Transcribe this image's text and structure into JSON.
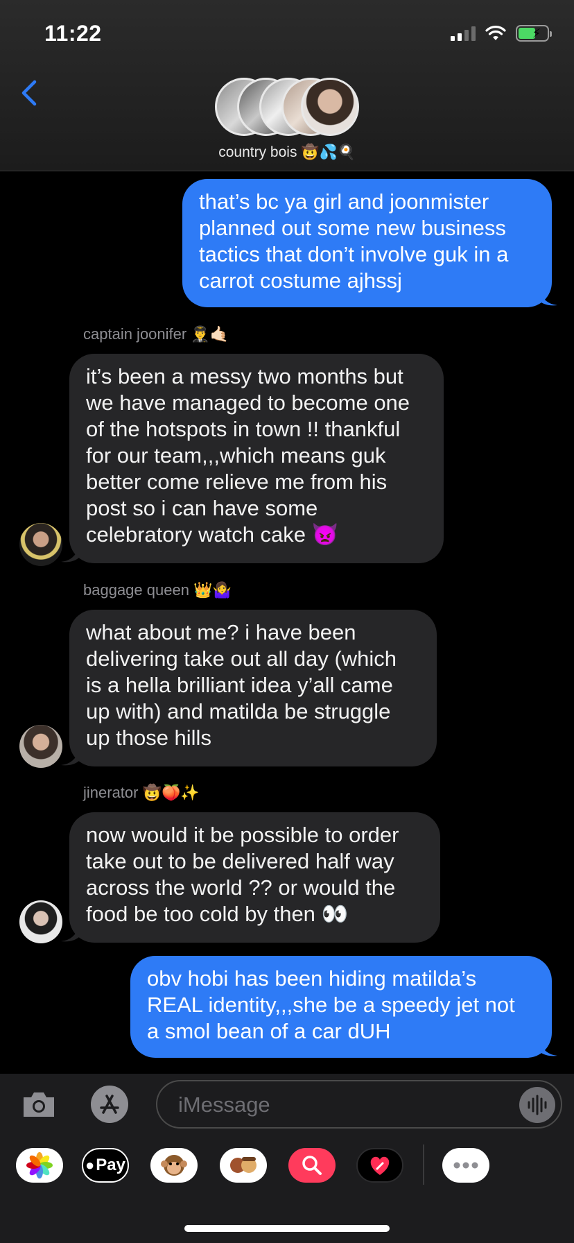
{
  "status_bar": {
    "time": "11:22"
  },
  "header": {
    "group_name": "country bois 🤠💦🍳",
    "member_avatars": [
      "member-1",
      "member-2",
      "member-3",
      "member-4",
      "member-5"
    ]
  },
  "messages": [
    {
      "type": "sent",
      "text": "that’s bc ya girl and joonmister\nplanned out some new business\ntactics that don’t involve guk in a\ncarrot costume ajhssj"
    },
    {
      "type": "received",
      "sender": "captain joonifer 👨‍✈️🤙🏻",
      "text": "it’s been a messy two months but\nwe have managed to become one\nof the hotspots in town !! thankful\nfor our team,,,which means guk\nbetter come relieve me from his\npost so i can have some\ncelebratory watch cake 👿"
    },
    {
      "type": "received",
      "sender": "baggage queen 👑🤷‍♀️",
      "text": "what about me? i have been\ndelivering take out all day (which\nis a hella brilliant idea y’all came\nup with) and matilda be struggle\nup those hills"
    },
    {
      "type": "received",
      "sender": "jinerator 🤠🍑✨",
      "text": "now would it be possible to order\ntake out to be delivered half way\nacross the world ?? or would the\nfood be too cold by then 👀"
    },
    {
      "type": "sent",
      "text": "obv hobi has been hiding matilda’s\nREAL identity,,,she be a speedy jet not\na smol bean of a car dUH"
    }
  ],
  "input": {
    "placeholder": "iMessage"
  },
  "app_drawer": {
    "apple_pay_label": "Pay",
    "items": [
      "photos-app-icon",
      "apple-pay-icon",
      "animoji-icon",
      "memoji-icon",
      "search-images-icon",
      "digital-touch-icon",
      "more-apps-icon"
    ]
  },
  "colors": {
    "sent_bubble": "#2e7bf6",
    "received_bubble": "#262628",
    "accent_blue": "#2e7bf6",
    "battery_green": "#4cd964"
  }
}
